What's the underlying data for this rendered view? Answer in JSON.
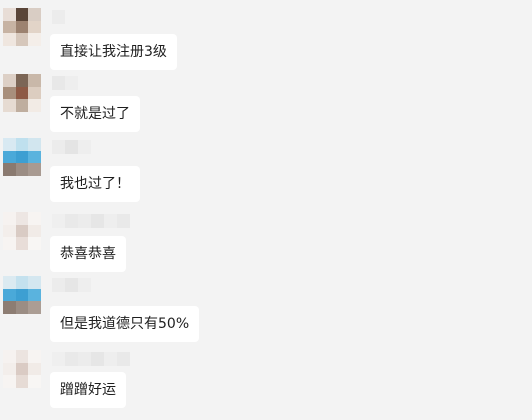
{
  "messages": [
    {
      "text": "直接让我注册3级",
      "avatar_icon": "mosaic-avatar-brown"
    },
    {
      "text": "不就是过了",
      "avatar_icon": "mosaic-avatar-brown"
    },
    {
      "text": "我也过了！",
      "avatar_icon": "mosaic-avatar-blue"
    },
    {
      "text": "恭喜恭喜",
      "avatar_icon": "mosaic-avatar-light"
    },
    {
      "text": "但是我道德只有50%",
      "avatar_icon": "mosaic-avatar-blue"
    },
    {
      "text": "蹭蹭好运",
      "avatar_icon": "mosaic-avatar-light"
    }
  ],
  "colors": {
    "background": "#f3f3f3",
    "bubble": "#ffffff",
    "text": "#1e1e1e"
  }
}
